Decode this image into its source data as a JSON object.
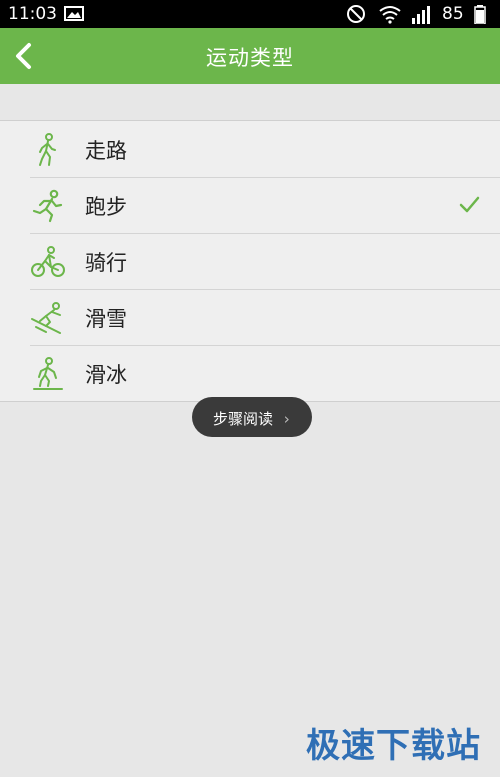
{
  "status_bar": {
    "time": "11:03",
    "battery": "85",
    "icons": [
      "image-icon",
      "mute-icon",
      "wifi-icon",
      "signal-icon",
      "battery-icon"
    ]
  },
  "header": {
    "title": "运动类型",
    "back_icon": "chevron-left-icon",
    "background": "#6cb64b"
  },
  "sport_types": [
    {
      "label": "走路",
      "icon": "walking-icon",
      "selected": false
    },
    {
      "label": "跑步",
      "icon": "running-icon",
      "selected": true
    },
    {
      "label": "骑行",
      "icon": "cycling-icon",
      "selected": false
    },
    {
      "label": "滑雪",
      "icon": "skiing-icon",
      "selected": false
    },
    {
      "label": "滑冰",
      "icon": "skating-icon",
      "selected": false
    }
  ],
  "toast": {
    "label": "步骤阅读",
    "arrow": "›"
  },
  "watermark": "极速下载站",
  "colors": {
    "accent": "#6cb64b",
    "watermark": "#2f6fb5"
  }
}
